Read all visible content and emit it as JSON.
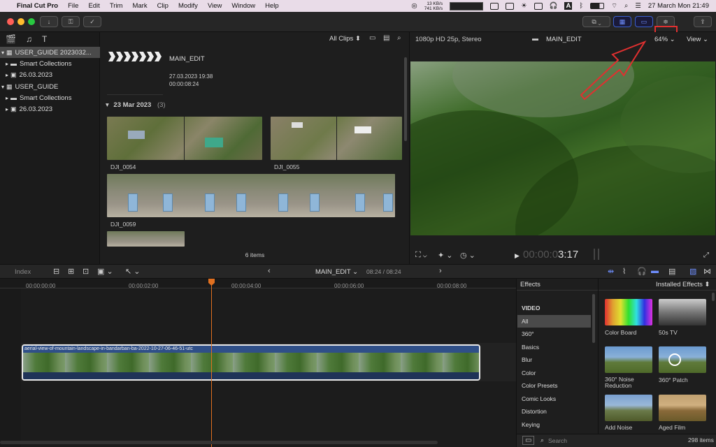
{
  "menubar": {
    "app": "Final Cut Pro",
    "items": [
      "File",
      "Edit",
      "Trim",
      "Mark",
      "Clip",
      "Modify",
      "View",
      "Window",
      "Help"
    ],
    "net_up": "13 KB/s",
    "net_down": "741 KB/s",
    "clock": "27 March Mon  21:49"
  },
  "library": {
    "items": [
      {
        "label": "USER_GUIDE 2023032...",
        "level": 0,
        "icon": "library-icon"
      },
      {
        "label": "Smart Collections",
        "level": 1,
        "icon": "folder-icon"
      },
      {
        "label": "26.03.2023",
        "level": 1,
        "icon": "event-icon"
      },
      {
        "label": "USER_GUIDE",
        "level": 0,
        "icon": "library-icon"
      },
      {
        "label": "Smart Collections",
        "level": 1,
        "icon": "folder-icon"
      },
      {
        "label": "26.03.2023",
        "level": 1,
        "icon": "event-icon"
      }
    ]
  },
  "browser": {
    "filter": "All Clips ⬍",
    "project": "MAIN_EDIT",
    "date": "27.03.2023 19:38",
    "duration": "00:00:08:24",
    "group_label": "23 Mar 2023",
    "group_count": "(3)",
    "clips": [
      "DJI_0054",
      "DJI_0055",
      "DJI_0059"
    ],
    "count": "6 items"
  },
  "viewer": {
    "format": "1080p HD 25p, Stereo",
    "title": "MAIN_EDIT",
    "zoom": "64%",
    "view": "View",
    "timecode_dim": "00:00:0",
    "timecode": "3:17"
  },
  "timeline": {
    "index": "Index",
    "project": "MAIN_EDIT",
    "position": "08:24 / 08:24",
    "ticks": [
      "00:00:00:00",
      "00:00:02:00",
      "00:00:04:00",
      "00:00:06:00",
      "00:00:08:00"
    ],
    "clip_name": "aerial-view-of-mountain-landscape-in-bandarban-ba-2022-10-27-06-46-51-utc"
  },
  "effects": {
    "title": "Effects",
    "installed": "Installed Effects",
    "categories": [
      "VIDEO",
      "All",
      "360°",
      "Basics",
      "Blur",
      "Color",
      "Color Presets",
      "Comic Looks",
      "Distortion",
      "Keying"
    ],
    "selected": "All",
    "items": [
      "Color Board",
      "50s TV",
      "360° Noise Reduction",
      "360° Patch",
      "Add Noise",
      "Aged Film"
    ],
    "search_placeholder": "Search",
    "count": "298 items"
  },
  "colors": {
    "accent": "#3a5fd0",
    "highlight_red": "#e03030",
    "playhead": "#e07020"
  }
}
